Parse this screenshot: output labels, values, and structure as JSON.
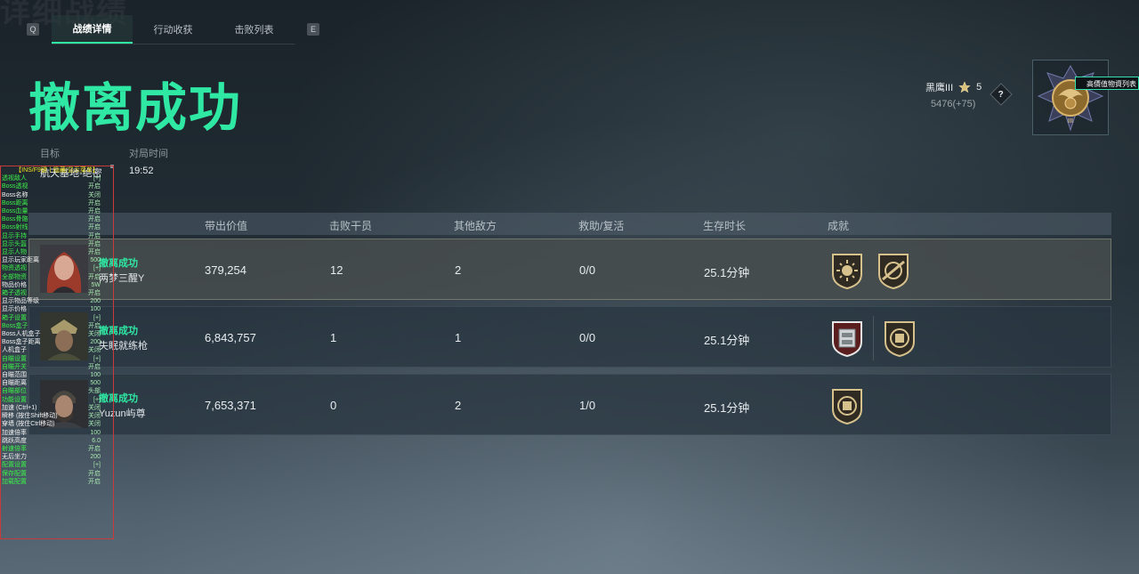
{
  "tabs": {
    "left_key": "Q",
    "right_key": "E",
    "items": [
      {
        "label": "战绩详情"
      },
      {
        "label": "行动收获"
      },
      {
        "label": "击败列表"
      }
    ]
  },
  "result_title": "撤离成功",
  "info": {
    "target_label": "目标",
    "target_value": "航天基地-绝密",
    "time_label": "对局时间",
    "time_value": "19:52"
  },
  "rank": {
    "name": "黑鹰III",
    "stars": "5",
    "score": "5476(+75)",
    "help": "?",
    "emblem_tag": "高價值物資列表"
  },
  "table": {
    "headers": [
      "带出价值",
      "击败干员",
      "其他敌方",
      "救助/复活",
      "生存时长",
      "成就"
    ],
    "rows": [
      {
        "status": "撤离成功",
        "name": "两梦三醒Y",
        "value": "379,254",
        "kills": "12",
        "other": "2",
        "rescue": "0/0",
        "survive": "25.1分钟",
        "achievements": [
          "sun-badge-icon",
          "rifle-scope-badge-icon"
        ]
      },
      {
        "status": "撤离成功",
        "name": "失眠就练枪",
        "value": "6,843,757",
        "kills": "1",
        "other": "1",
        "rescue": "0/0",
        "survive": "25.1分钟",
        "achievements": [
          "safe-box-badge-icon",
          "armor-badge-icon"
        ]
      },
      {
        "status": "撤离成功",
        "name": "Yuzun屿尊",
        "value": "7,653,371",
        "kills": "0",
        "other": "2",
        "rescue": "1/0",
        "survive": "25.1分钟",
        "achievements": [
          "armor-badge-icon"
        ]
      }
    ]
  },
  "debug": {
    "title": "【INS/F9键丨隐藏/显示菜单】",
    "rows": [
      {
        "k": "透视敌人",
        "v": "[+]",
        "g": true
      },
      {
        "k": "Boss透视",
        "v": "开启",
        "g": true
      },
      {
        "k": "Boss名称",
        "v": "关闭",
        "g": false
      },
      {
        "k": "Boss距离",
        "v": "开启",
        "g": true
      },
      {
        "k": "Boss血量",
        "v": "开启",
        "g": true
      },
      {
        "k": "Boss骨骼",
        "v": "开启",
        "g": true
      },
      {
        "k": "Boss射线",
        "v": "开启",
        "g": true
      },
      {
        "k": "显示手持",
        "v": "开启",
        "g": true
      },
      {
        "k": "显示头盔",
        "v": "开启",
        "g": true
      },
      {
        "k": "显示人物",
        "v": "开启",
        "g": true
      },
      {
        "k": "显示玩家距离",
        "v": "500",
        "g": false
      },
      {
        "k": "物资透视",
        "v": "[+]",
        "g": true
      },
      {
        "k": "全部物资",
        "v": "开启",
        "g": true
      },
      {
        "k": "物品价格",
        "v": "5W",
        "g": false
      },
      {
        "k": "箱子透视",
        "v": "开启",
        "g": true
      },
      {
        "k": "显示物品等级",
        "v": "200",
        "g": false
      },
      {
        "k": "显示价格",
        "v": "100",
        "g": false
      },
      {
        "k": "箱子设置",
        "v": "[+]",
        "g": true
      },
      {
        "k": "Boss盒子",
        "v": "开启",
        "g": true
      },
      {
        "k": "Boss人机盒子",
        "v": "关闭",
        "g": false
      },
      {
        "k": "Boss盒子距离",
        "v": "200",
        "g": false
      },
      {
        "k": "人机盒子",
        "v": "关闭",
        "g": false
      },
      {
        "k": "自瞄设置",
        "v": "[+]",
        "g": true
      },
      {
        "k": "自瞄开关",
        "v": "开启",
        "g": true
      },
      {
        "k": "自瞄范围",
        "v": "100",
        "g": false
      },
      {
        "k": "自瞄距离",
        "v": "500",
        "g": false
      },
      {
        "k": "自瞄部位",
        "v": "头部",
        "g": true
      },
      {
        "k": "功能设置",
        "v": "[+]",
        "g": true
      },
      {
        "k": "加速 (Ctrl+1)",
        "v": "关闭",
        "g": false
      },
      {
        "k": "瞬移 (按住Shift移动)",
        "v": "关闭",
        "g": false
      },
      {
        "k": "穿墙 (按住Ctrl移动)",
        "v": "关闭",
        "g": false
      },
      {
        "k": "加速倍率",
        "v": "100",
        "g": false
      },
      {
        "k": "跳跃高度",
        "v": "6.0",
        "g": false
      },
      {
        "k": "射速倍率",
        "v": "开启",
        "g": true
      },
      {
        "k": "无后坐力",
        "v": "200",
        "g": false
      },
      {
        "k": "配置设置",
        "v": "[+]",
        "g": true
      },
      {
        "k": "保存配置",
        "v": "开启",
        "g": true
      },
      {
        "k": "加载配置",
        "v": "开启",
        "g": true
      }
    ]
  }
}
